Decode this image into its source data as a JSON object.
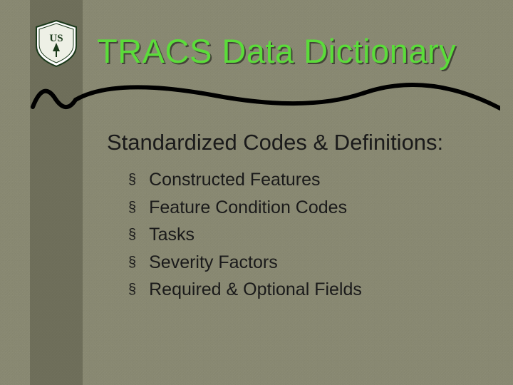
{
  "slide": {
    "title": "TRACS Data Dictionary",
    "subtitle": "Standardized Codes & Definitions:",
    "bullets": [
      "Constructed Features",
      "Feature Condition Codes",
      "Tasks",
      "Severity Factors",
      "Required & Optional Fields"
    ],
    "logo_label": "US Forest Service"
  },
  "colors": {
    "accent": "#5bdc3a",
    "bg": "#8a8a72",
    "sidebar": "#6f6f5a",
    "text": "#1a1a1a"
  }
}
